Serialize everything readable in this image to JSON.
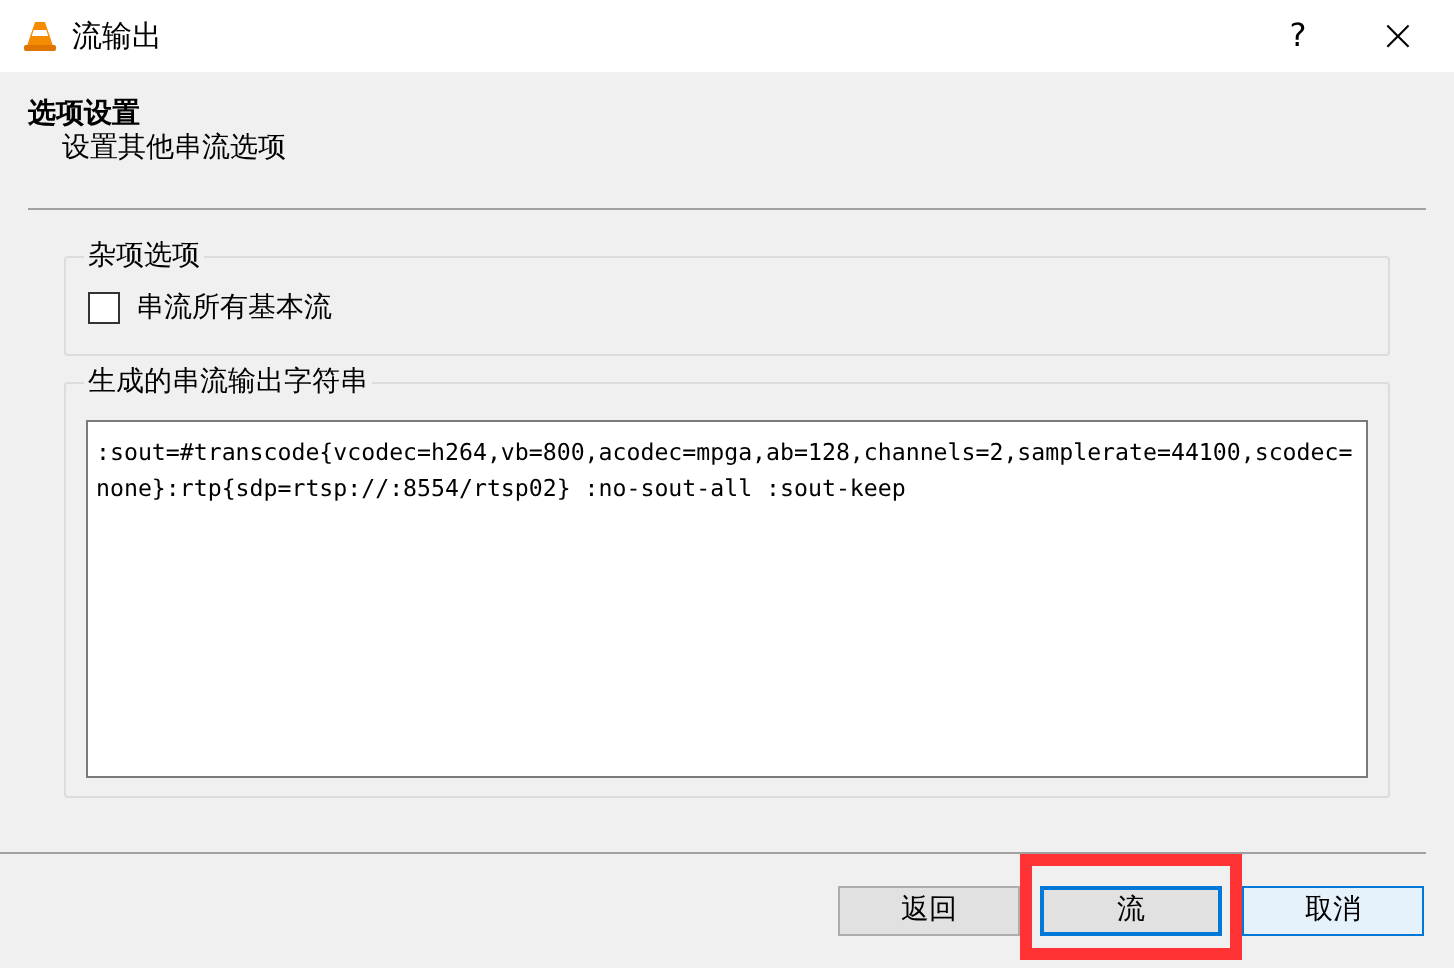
{
  "window": {
    "title": "流输出",
    "help": "?",
    "close": "×"
  },
  "header": {
    "title": "选项设置",
    "subtitle": "设置其他串流选项"
  },
  "misc_group": {
    "title": "杂项选项",
    "checkbox": {
      "label": "串流所有基本流",
      "checked": false
    }
  },
  "output_group": {
    "title": "生成的串流输出字符串",
    "value": ":sout=#transcode{vcodec=h264,vb=800,acodec=mpga,ab=128,channels=2,samplerate=44100,scodec=none}:rtp{sdp=rtsp://:8554/rtsp02} :no-sout-all :sout-keep"
  },
  "buttons": [
    {
      "label": "返回",
      "kind": "normal",
      "highlighted": false
    },
    {
      "label": "流",
      "kind": "default",
      "highlighted": true
    },
    {
      "label": "取消",
      "kind": "hover",
      "highlighted": false
    }
  ]
}
